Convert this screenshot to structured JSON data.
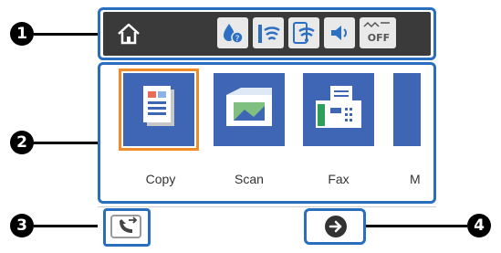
{
  "callouts": [
    "1",
    "2",
    "3",
    "4"
  ],
  "status_bar": {
    "icons": [
      "home-icon",
      "ink-status-icon",
      "network-wifi-icon",
      "wifi-direct-icon",
      "volume-icon",
      "quiet-mode-off-icon"
    ],
    "quiet_label": "OFF"
  },
  "apps": [
    {
      "label": "Copy",
      "icon": "copy-icon",
      "selected": true
    },
    {
      "label": "Scan",
      "icon": "scan-icon",
      "selected": false
    },
    {
      "label": "Fax",
      "icon": "fax-icon",
      "selected": false
    },
    {
      "label": "M",
      "icon": "more-icon",
      "selected": false
    }
  ],
  "bottom_bar": {
    "left_button_icon": "fax-send-icon",
    "right_button_icon": "arrow-right-icon"
  },
  "colors": {
    "frame": "#2a6ebf",
    "tile": "#3e66b5",
    "selected_outline": "#f08a2a",
    "status_bg": "#3a3a3a"
  }
}
